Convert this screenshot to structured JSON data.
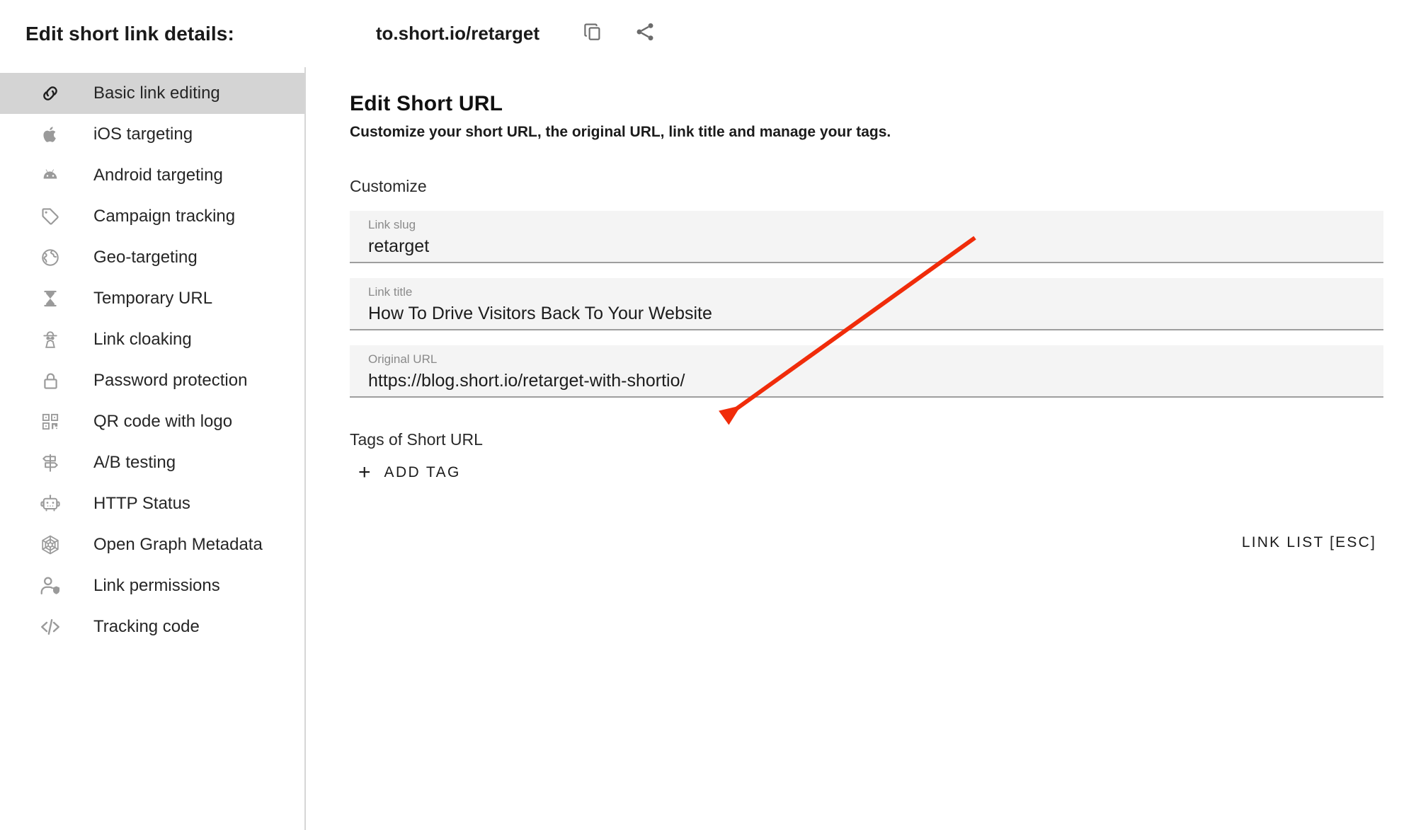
{
  "header": {
    "title": "Edit short link details:",
    "short_url": "to.short.io/retarget",
    "copy_icon": "copy-icon",
    "share_icon": "share-icon"
  },
  "sidebar": {
    "items": [
      {
        "label": "Basic link editing",
        "icon": "link-icon",
        "active": true
      },
      {
        "label": "iOS targeting",
        "icon": "apple-icon",
        "active": false
      },
      {
        "label": "Android targeting",
        "icon": "android-icon",
        "active": false
      },
      {
        "label": "Campaign tracking",
        "icon": "tag-icon",
        "active": false
      },
      {
        "label": "Geo-targeting",
        "icon": "globe-icon",
        "active": false
      },
      {
        "label": "Temporary URL",
        "icon": "hourglass-icon",
        "active": false
      },
      {
        "label": "Link cloaking",
        "icon": "spy-icon",
        "active": false
      },
      {
        "label": "Password protection",
        "icon": "lock-icon",
        "active": false
      },
      {
        "label": "QR code with logo",
        "icon": "qr-code-icon",
        "active": false
      },
      {
        "label": "A/B testing",
        "icon": "signpost-icon",
        "active": false
      },
      {
        "label": "HTTP Status",
        "icon": "robot-icon",
        "active": false
      },
      {
        "label": "Open Graph Metadata",
        "icon": "spiderweb-icon",
        "active": false
      },
      {
        "label": "Link permissions",
        "icon": "user-shield-icon",
        "active": false
      },
      {
        "label": "Tracking code",
        "icon": "code-icon",
        "active": false
      }
    ]
  },
  "main": {
    "title": "Edit Short URL",
    "subtitle": "Customize your short URL, the original URL, link title and manage your tags.",
    "customize_label": "Customize",
    "fields": [
      {
        "label": "Link slug",
        "value": "retarget"
      },
      {
        "label": "Link title",
        "value": "How To Drive Visitors Back To Your Website"
      },
      {
        "label": "Original URL",
        "value": "https://blog.short.io/retarget-with-shortio/"
      }
    ],
    "tags_label": "Tags of Short URL",
    "add_tag_label": "ADD TAG",
    "add_tag_plus": "+",
    "link_list_label": "LINK LIST [ESC]"
  },
  "annotation": {
    "arrow_color": "#f02c0a",
    "name": "red-arrow-pointing-to-original-url"
  },
  "colors": {
    "active_nav_bg": "#d4d4d4",
    "field_bg": "#f4f4f4",
    "field_underline": "#9e9e9e",
    "icon_gray": "#9a9a9a"
  }
}
